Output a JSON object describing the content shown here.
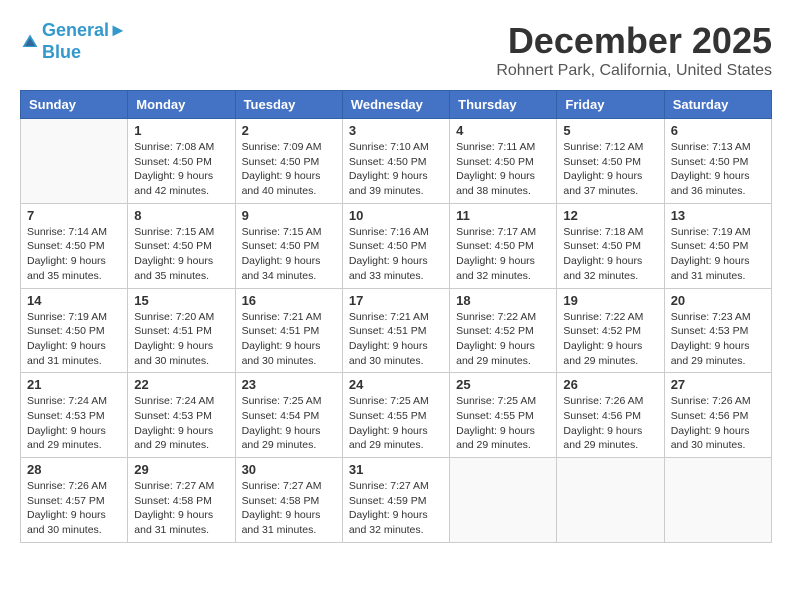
{
  "header": {
    "logo_line1": "General",
    "logo_line2": "Blue",
    "month": "December 2025",
    "location": "Rohnert Park, California, United States"
  },
  "weekdays": [
    "Sunday",
    "Monday",
    "Tuesday",
    "Wednesday",
    "Thursday",
    "Friday",
    "Saturday"
  ],
  "weeks": [
    [
      {
        "day": "",
        "sunrise": "",
        "sunset": "",
        "daylight": ""
      },
      {
        "day": "1",
        "sunrise": "Sunrise: 7:08 AM",
        "sunset": "Sunset: 4:50 PM",
        "daylight": "Daylight: 9 hours and 42 minutes."
      },
      {
        "day": "2",
        "sunrise": "Sunrise: 7:09 AM",
        "sunset": "Sunset: 4:50 PM",
        "daylight": "Daylight: 9 hours and 40 minutes."
      },
      {
        "day": "3",
        "sunrise": "Sunrise: 7:10 AM",
        "sunset": "Sunset: 4:50 PM",
        "daylight": "Daylight: 9 hours and 39 minutes."
      },
      {
        "day": "4",
        "sunrise": "Sunrise: 7:11 AM",
        "sunset": "Sunset: 4:50 PM",
        "daylight": "Daylight: 9 hours and 38 minutes."
      },
      {
        "day": "5",
        "sunrise": "Sunrise: 7:12 AM",
        "sunset": "Sunset: 4:50 PM",
        "daylight": "Daylight: 9 hours and 37 minutes."
      },
      {
        "day": "6",
        "sunrise": "Sunrise: 7:13 AM",
        "sunset": "Sunset: 4:50 PM",
        "daylight": "Daylight: 9 hours and 36 minutes."
      }
    ],
    [
      {
        "day": "7",
        "sunrise": "Sunrise: 7:14 AM",
        "sunset": "Sunset: 4:50 PM",
        "daylight": "Daylight: 9 hours and 35 minutes."
      },
      {
        "day": "8",
        "sunrise": "Sunrise: 7:15 AM",
        "sunset": "Sunset: 4:50 PM",
        "daylight": "Daylight: 9 hours and 35 minutes."
      },
      {
        "day": "9",
        "sunrise": "Sunrise: 7:15 AM",
        "sunset": "Sunset: 4:50 PM",
        "daylight": "Daylight: 9 hours and 34 minutes."
      },
      {
        "day": "10",
        "sunrise": "Sunrise: 7:16 AM",
        "sunset": "Sunset: 4:50 PM",
        "daylight": "Daylight: 9 hours and 33 minutes."
      },
      {
        "day": "11",
        "sunrise": "Sunrise: 7:17 AM",
        "sunset": "Sunset: 4:50 PM",
        "daylight": "Daylight: 9 hours and 32 minutes."
      },
      {
        "day": "12",
        "sunrise": "Sunrise: 7:18 AM",
        "sunset": "Sunset: 4:50 PM",
        "daylight": "Daylight: 9 hours and 32 minutes."
      },
      {
        "day": "13",
        "sunrise": "Sunrise: 7:19 AM",
        "sunset": "Sunset: 4:50 PM",
        "daylight": "Daylight: 9 hours and 31 minutes."
      }
    ],
    [
      {
        "day": "14",
        "sunrise": "Sunrise: 7:19 AM",
        "sunset": "Sunset: 4:50 PM",
        "daylight": "Daylight: 9 hours and 31 minutes."
      },
      {
        "day": "15",
        "sunrise": "Sunrise: 7:20 AM",
        "sunset": "Sunset: 4:51 PM",
        "daylight": "Daylight: 9 hours and 30 minutes."
      },
      {
        "day": "16",
        "sunrise": "Sunrise: 7:21 AM",
        "sunset": "Sunset: 4:51 PM",
        "daylight": "Daylight: 9 hours and 30 minutes."
      },
      {
        "day": "17",
        "sunrise": "Sunrise: 7:21 AM",
        "sunset": "Sunset: 4:51 PM",
        "daylight": "Daylight: 9 hours and 30 minutes."
      },
      {
        "day": "18",
        "sunrise": "Sunrise: 7:22 AM",
        "sunset": "Sunset: 4:52 PM",
        "daylight": "Daylight: 9 hours and 29 minutes."
      },
      {
        "day": "19",
        "sunrise": "Sunrise: 7:22 AM",
        "sunset": "Sunset: 4:52 PM",
        "daylight": "Daylight: 9 hours and 29 minutes."
      },
      {
        "day": "20",
        "sunrise": "Sunrise: 7:23 AM",
        "sunset": "Sunset: 4:53 PM",
        "daylight": "Daylight: 9 hours and 29 minutes."
      }
    ],
    [
      {
        "day": "21",
        "sunrise": "Sunrise: 7:24 AM",
        "sunset": "Sunset: 4:53 PM",
        "daylight": "Daylight: 9 hours and 29 minutes."
      },
      {
        "day": "22",
        "sunrise": "Sunrise: 7:24 AM",
        "sunset": "Sunset: 4:53 PM",
        "daylight": "Daylight: 9 hours and 29 minutes."
      },
      {
        "day": "23",
        "sunrise": "Sunrise: 7:25 AM",
        "sunset": "Sunset: 4:54 PM",
        "daylight": "Daylight: 9 hours and 29 minutes."
      },
      {
        "day": "24",
        "sunrise": "Sunrise: 7:25 AM",
        "sunset": "Sunset: 4:55 PM",
        "daylight": "Daylight: 9 hours and 29 minutes."
      },
      {
        "day": "25",
        "sunrise": "Sunrise: 7:25 AM",
        "sunset": "Sunset: 4:55 PM",
        "daylight": "Daylight: 9 hours and 29 minutes."
      },
      {
        "day": "26",
        "sunrise": "Sunrise: 7:26 AM",
        "sunset": "Sunset: 4:56 PM",
        "daylight": "Daylight: 9 hours and 29 minutes."
      },
      {
        "day": "27",
        "sunrise": "Sunrise: 7:26 AM",
        "sunset": "Sunset: 4:56 PM",
        "daylight": "Daylight: 9 hours and 30 minutes."
      }
    ],
    [
      {
        "day": "28",
        "sunrise": "Sunrise: 7:26 AM",
        "sunset": "Sunset: 4:57 PM",
        "daylight": "Daylight: 9 hours and 30 minutes."
      },
      {
        "day": "29",
        "sunrise": "Sunrise: 7:27 AM",
        "sunset": "Sunset: 4:58 PM",
        "daylight": "Daylight: 9 hours and 31 minutes."
      },
      {
        "day": "30",
        "sunrise": "Sunrise: 7:27 AM",
        "sunset": "Sunset: 4:58 PM",
        "daylight": "Daylight: 9 hours and 31 minutes."
      },
      {
        "day": "31",
        "sunrise": "Sunrise: 7:27 AM",
        "sunset": "Sunset: 4:59 PM",
        "daylight": "Daylight: 9 hours and 32 minutes."
      },
      {
        "day": "",
        "sunrise": "",
        "sunset": "",
        "daylight": ""
      },
      {
        "day": "",
        "sunrise": "",
        "sunset": "",
        "daylight": ""
      },
      {
        "day": "",
        "sunrise": "",
        "sunset": "",
        "daylight": ""
      }
    ]
  ]
}
